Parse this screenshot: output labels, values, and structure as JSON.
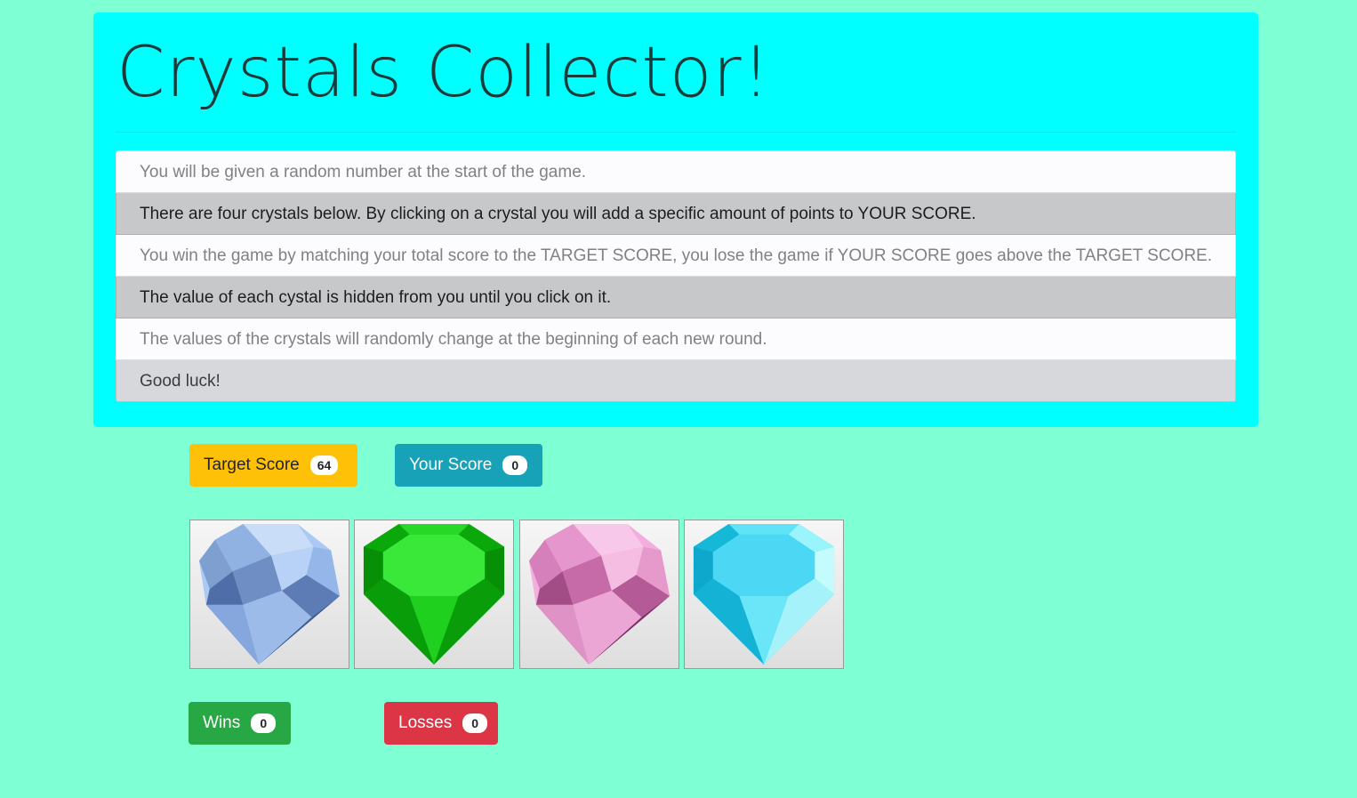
{
  "header": {
    "title": "Crystals Collector!"
  },
  "rules": [
    "You will be given a random number at the start of the game.",
    "There are four crystals below. By clicking on a crystal you will add a specific amount of points to YOUR SCORE.",
    "You win the game by matching your total score to the TARGET SCORE, you lose the game if YOUR SCORE goes above the TARGET SCORE.",
    "The value of each cystal is hidden from you until you click on it.",
    "The values of the crystals will randomly change at the beginning of each new round.",
    "Good luck!"
  ],
  "scoreboard": {
    "target_label": "Target Score",
    "target_value": "64",
    "score_label": "Your Score",
    "score_value": "0"
  },
  "crystals": [
    {
      "name": "blue-crystal",
      "color": "#a9c8f5"
    },
    {
      "name": "green-crystal",
      "color": "#11c411"
    },
    {
      "name": "pink-crystal",
      "color": "#f0a8d8"
    },
    {
      "name": "cyan-crystal",
      "color": "#34dcf0"
    }
  ],
  "record": {
    "wins_label": "Wins",
    "wins_value": "0",
    "losses_label": "Losses",
    "losses_value": "0"
  }
}
